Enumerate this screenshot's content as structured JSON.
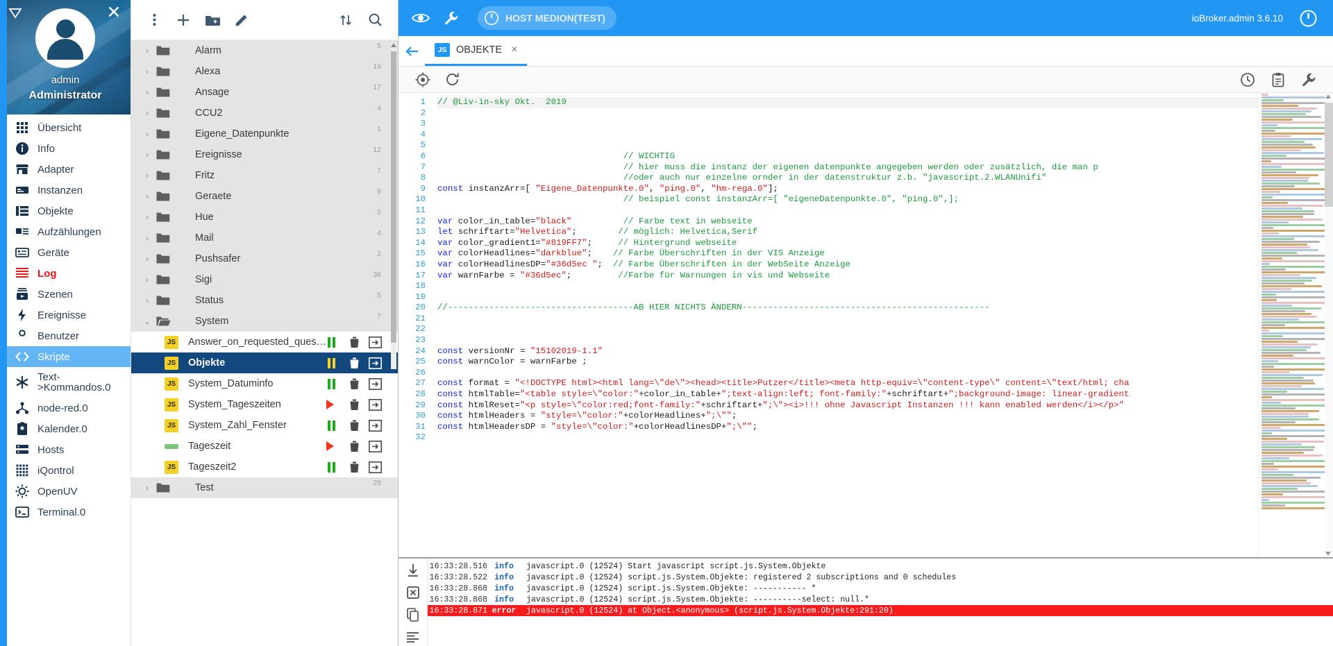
{
  "window": {
    "version": "ioBroker.admin 3.6.10",
    "host_chip": "HOST MEDION(TEST)"
  },
  "user": {
    "name": "admin",
    "role": "Administrator"
  },
  "sidebar": {
    "items": [
      {
        "label": "Übersicht",
        "icon": "grid-icon",
        "state": "normal"
      },
      {
        "label": "Info",
        "icon": "info-icon",
        "state": "normal"
      },
      {
        "label": "Adapter",
        "icon": "store-icon",
        "state": "normal"
      },
      {
        "label": "Instanzen",
        "icon": "instances-icon",
        "state": "normal"
      },
      {
        "label": "Objekte",
        "icon": "objects-icon",
        "state": "normal"
      },
      {
        "label": "Aufzählungen",
        "icon": "enums-icon",
        "state": "normal"
      },
      {
        "label": "Geräte",
        "icon": "devices-icon",
        "state": "normal"
      },
      {
        "label": "Log",
        "icon": "log-icon",
        "state": "alert"
      },
      {
        "label": "Szenen",
        "icon": "scenes-icon",
        "state": "normal"
      },
      {
        "label": "Ereignisse",
        "icon": "events-icon",
        "state": "normal"
      },
      {
        "label": "Benutzer",
        "icon": "user-icon",
        "state": "normal"
      },
      {
        "label": "Skripte",
        "icon": "code-icon",
        "state": "selected"
      },
      {
        "label": "Text-\n>Kommandos.0",
        "icon": "asterisk-icon",
        "state": "normal"
      },
      {
        "label": "node-red.0",
        "icon": "nodered-icon",
        "state": "normal"
      },
      {
        "label": "Kalender.0",
        "icon": "calendar-icon",
        "state": "normal"
      },
      {
        "label": "Hosts",
        "icon": "hosts-icon",
        "state": "normal"
      },
      {
        "label": "iQontrol",
        "icon": "iqontrol-icon",
        "state": "normal"
      },
      {
        "label": "OpenUV",
        "icon": "sun-icon",
        "state": "normal"
      },
      {
        "label": "Terminal.0",
        "icon": "terminal-icon",
        "state": "normal"
      }
    ]
  },
  "tree": {
    "toolbar": {
      "more": "more-vert-icon",
      "add_script": "plus-icon",
      "add_folder": "new-folder-icon",
      "edit": "pencil-icon",
      "sort": "sort-icon",
      "search": "search-icon"
    },
    "rows": [
      {
        "type": "folder",
        "label": "Alarm",
        "count": "5",
        "expanded": false
      },
      {
        "type": "folder",
        "label": "Alexa",
        "count": "19",
        "expanded": false
      },
      {
        "type": "folder",
        "label": "Ansage",
        "count": "17",
        "expanded": false
      },
      {
        "type": "folder",
        "label": "CCU2",
        "count": "4",
        "expanded": false
      },
      {
        "type": "folder",
        "label": "Eigene_Datenpunkte",
        "count": "1",
        "expanded": false
      },
      {
        "type": "folder",
        "label": "Ereignisse",
        "count": "12",
        "expanded": false
      },
      {
        "type": "folder",
        "label": "Fritz",
        "count": "7",
        "expanded": false
      },
      {
        "type": "folder",
        "label": "Geraete",
        "count": "9",
        "expanded": false
      },
      {
        "type": "folder",
        "label": "Hue",
        "count": "5",
        "expanded": false
      },
      {
        "type": "folder",
        "label": "Mail",
        "count": "4",
        "expanded": false
      },
      {
        "type": "folder",
        "label": "Pushsafer",
        "count": "2",
        "expanded": false
      },
      {
        "type": "folder",
        "label": "Sigi",
        "count": "36",
        "expanded": false
      },
      {
        "type": "folder",
        "label": "Status",
        "count": "5",
        "expanded": false
      },
      {
        "type": "folder",
        "label": "System",
        "count": "7",
        "expanded": true
      },
      {
        "type": "script",
        "label": "Answer_on_requested_question",
        "status": "running",
        "selected": false
      },
      {
        "type": "script",
        "label": "Objekte",
        "status": "running",
        "selected": true
      },
      {
        "type": "script",
        "label": "System_Datuminfo",
        "status": "running",
        "selected": false
      },
      {
        "type": "script",
        "label": "System_Tageszeiten",
        "status": "stopped",
        "selected": false
      },
      {
        "type": "script",
        "label": "System_Zahl_Fenster",
        "status": "running",
        "selected": false
      },
      {
        "type": "script",
        "label": "Tageszeit",
        "status": "stopped",
        "selected": false,
        "badge": "blockly"
      },
      {
        "type": "script",
        "label": "Tageszeit2",
        "status": "running",
        "selected": false
      },
      {
        "type": "folder",
        "label": "Test",
        "count": "29",
        "expanded": false
      }
    ]
  },
  "tab": {
    "label": "OBJEKTE",
    "js_badge": "JS",
    "close": "×",
    "back_icon": "arrow-back-icon"
  },
  "editor": {
    "toolbar": {
      "locate": "locate-icon",
      "reload": "reload-icon",
      "history": "history-icon",
      "clipboard": "clipboard-icon",
      "settings": "wrench-icon"
    },
    "lines": [
      {
        "n": "1",
        "tokens": [
          {
            "t": "com",
            "v": "// @Liv-in-sky Okt.  2019"
          }
        ]
      },
      {
        "n": "2",
        "tokens": []
      },
      {
        "n": "3",
        "tokens": []
      },
      {
        "n": "4",
        "tokens": []
      },
      {
        "n": "5",
        "tokens": []
      },
      {
        "n": "6",
        "tokens": [
          {
            "t": "txt",
            "v": "                                    "
          },
          {
            "t": "com",
            "v": "// WICHTIG"
          }
        ]
      },
      {
        "n": "7",
        "tokens": [
          {
            "t": "txt",
            "v": "                                    "
          },
          {
            "t": "com",
            "v": "// hier muss die instanz der eigenen datenpunkte angegeben werden oder zusätzlich, die man p"
          }
        ]
      },
      {
        "n": "8",
        "tokens": [
          {
            "t": "txt",
            "v": "                                    "
          },
          {
            "t": "com",
            "v": "//oder auch nur einzelne ornder in der datenstruktur z.b. \"javascript.2.WLANUnifi\""
          }
        ]
      },
      {
        "n": "9",
        "tokens": [
          {
            "t": "kw",
            "v": "const"
          },
          {
            "t": "txt",
            "v": " instanzArr=[ "
          },
          {
            "t": "str",
            "v": "\"Eigene_Datenpunkte.0\""
          },
          {
            "t": "txt",
            "v": ", "
          },
          {
            "t": "str",
            "v": "\"ping.0\""
          },
          {
            "t": "txt",
            "v": ", "
          },
          {
            "t": "str",
            "v": "\"hm-rega.0\""
          },
          {
            "t": "txt",
            "v": "];"
          }
        ]
      },
      {
        "n": "10",
        "tokens": [
          {
            "t": "txt",
            "v": "                                    "
          },
          {
            "t": "com",
            "v": "// beispiel const instanzArr=[ \"eigeneDatenpunkte.0\", \"ping.0\",];"
          }
        ]
      },
      {
        "n": "11",
        "tokens": []
      },
      {
        "n": "12",
        "tokens": [
          {
            "t": "kw",
            "v": "var"
          },
          {
            "t": "txt",
            "v": " color_in_table="
          },
          {
            "t": "str",
            "v": "\"black\""
          },
          {
            "t": "txt",
            "v": "          "
          },
          {
            "t": "com",
            "v": "// Farbe text in webseite"
          }
        ]
      },
      {
        "n": "13",
        "tokens": [
          {
            "t": "kw",
            "v": "let"
          },
          {
            "t": "txt",
            "v": " schriftart="
          },
          {
            "t": "str",
            "v": "\"Helvetica\""
          },
          {
            "t": "txt",
            "v": ";        "
          },
          {
            "t": "com",
            "v": "// möglich: Helvetica,Serif"
          }
        ]
      },
      {
        "n": "14",
        "tokens": [
          {
            "t": "kw",
            "v": "var"
          },
          {
            "t": "txt",
            "v": " color_gradient1="
          },
          {
            "t": "str",
            "v": "\"#819FF7\""
          },
          {
            "t": "txt",
            "v": ";     "
          },
          {
            "t": "com",
            "v": "// Hintergrund webseite"
          }
        ]
      },
      {
        "n": "15",
        "tokens": [
          {
            "t": "kw",
            "v": "var"
          },
          {
            "t": "txt",
            "v": " colorHeadlines="
          },
          {
            "t": "str",
            "v": "\"darkblue\""
          },
          {
            "t": "txt",
            "v": ";    "
          },
          {
            "t": "com",
            "v": "// Farbe Überschriften in der VIS Anzeige"
          }
        ]
      },
      {
        "n": "16",
        "tokens": [
          {
            "t": "kw",
            "v": "var"
          },
          {
            "t": "txt",
            "v": " colorHeadlinesDP="
          },
          {
            "t": "str",
            "v": "\"#36d5ec \""
          },
          {
            "t": "txt",
            "v": ";  "
          },
          {
            "t": "com",
            "v": "// Farbe Überschriften in der WebSeite Anzeige"
          }
        ]
      },
      {
        "n": "17",
        "tokens": [
          {
            "t": "kw",
            "v": "var"
          },
          {
            "t": "txt",
            "v": " warnFarbe = "
          },
          {
            "t": "str",
            "v": "\"#36d5ec\""
          },
          {
            "t": "txt",
            "v": ";         "
          },
          {
            "t": "com",
            "v": "//Farbe für Warnungen in vis und Webseite"
          }
        ]
      },
      {
        "n": "18",
        "tokens": []
      },
      {
        "n": "19",
        "tokens": []
      },
      {
        "n": "20",
        "tokens": [
          {
            "t": "com",
            "v": "//------------------------------------AB HIER NICHTS ÄNDERN------------------------------------------------"
          }
        ]
      },
      {
        "n": "21",
        "tokens": []
      },
      {
        "n": "22",
        "tokens": []
      },
      {
        "n": "23",
        "tokens": []
      },
      {
        "n": "24",
        "tokens": [
          {
            "t": "kw",
            "v": "const"
          },
          {
            "t": "txt",
            "v": " versionNr = "
          },
          {
            "t": "str",
            "v": "\"15102019-1.1\""
          }
        ]
      },
      {
        "n": "25",
        "tokens": [
          {
            "t": "kw",
            "v": "const"
          },
          {
            "t": "txt",
            "v": " warnColor = warnFarbe ;"
          }
        ]
      },
      {
        "n": "26",
        "tokens": []
      },
      {
        "n": "27",
        "tokens": [
          {
            "t": "kw",
            "v": "const"
          },
          {
            "t": "txt",
            "v": " format = "
          },
          {
            "t": "str",
            "v": "\"<!DOCTYPE html><html lang=\\\"de\\\"><head><title>Putzer</title><meta http-equiv=\\\"content-type\\\" content=\\\"text/html; cha"
          }
        ]
      },
      {
        "n": "28",
        "tokens": [
          {
            "t": "kw",
            "v": "const"
          },
          {
            "t": "txt",
            "v": " htmlTable="
          },
          {
            "t": "str",
            "v": "\"<table style=\\\"color:\""
          },
          {
            "t": "txt",
            "v": "+color_in_table+"
          },
          {
            "t": "str",
            "v": "\";text-align:left; font-family:\""
          },
          {
            "t": "txt",
            "v": "+schriftart+"
          },
          {
            "t": "str",
            "v": "\";background-image: linear-gradient"
          }
        ]
      },
      {
        "n": "29",
        "tokens": [
          {
            "t": "kw",
            "v": "const"
          },
          {
            "t": "txt",
            "v": " htmlReset="
          },
          {
            "t": "str",
            "v": "\"<p style=\\\"color:red;font-family:\""
          },
          {
            "t": "txt",
            "v": "+schriftart+"
          },
          {
            "t": "str",
            "v": "\";\\\"><i>!!! ohne Javascript Instanzen !!! kann enabled werden</i></p>\""
          }
        ]
      },
      {
        "n": "30",
        "tokens": [
          {
            "t": "kw",
            "v": "const"
          },
          {
            "t": "txt",
            "v": " htmlHeaders = "
          },
          {
            "t": "str",
            "v": "\"style=\\\"color:\""
          },
          {
            "t": "txt",
            "v": "+colorHeadlines+"
          },
          {
            "t": "str",
            "v": "\";\\\"\""
          },
          {
            "t": "txt",
            "v": ";"
          }
        ]
      },
      {
        "n": "31",
        "tokens": [
          {
            "t": "kw",
            "v": "const"
          },
          {
            "t": "txt",
            "v": " htmlHeadersDP = "
          },
          {
            "t": "str",
            "v": "\"style=\\\"color:\""
          },
          {
            "t": "txt",
            "v": "+colorHeadlinesDP+"
          },
          {
            "t": "str",
            "v": "\";\\\"\""
          },
          {
            "t": "txt",
            "v": ";"
          }
        ]
      },
      {
        "n": "32",
        "tokens": []
      }
    ]
  },
  "log": {
    "tools": [
      "download-icon",
      "clear-icon",
      "copy-icon",
      "list-icon"
    ],
    "rows": [
      {
        "time": "16:33:28.516",
        "sev": "info",
        "msg": "javascript.0 (12524) Start javascript script.js.System.Objekte",
        "error": false
      },
      {
        "time": "16:33:28.522",
        "sev": "info",
        "msg": "javascript.0 (12524) script.js.System.Objekte: registered 2 subscriptions and 0 schedules",
        "error": false
      },
      {
        "time": "16:33:28.868",
        "sev": "info",
        "msg": "javascript.0 (12524) script.js.System.Objekte: ----------- *",
        "error": false
      },
      {
        "time": "16:33:28.868",
        "sev": "info",
        "msg": "javascript.0 (12524) script.js.System.Objekte: ----------select: null.*",
        "error": false
      },
      {
        "time": "16:33:28.871",
        "sev": "error",
        "msg": "javascript.0 (12524) at Object.<anonymous> (script.js.System.Objekte:291:20)",
        "error": true
      }
    ]
  },
  "colors": {
    "accent": "#2196f3",
    "selected_row": "#13487f",
    "alert": "#f01414",
    "error_bg": "#f41c1c",
    "js_badge": "#f5d024",
    "running": "#16b016"
  }
}
